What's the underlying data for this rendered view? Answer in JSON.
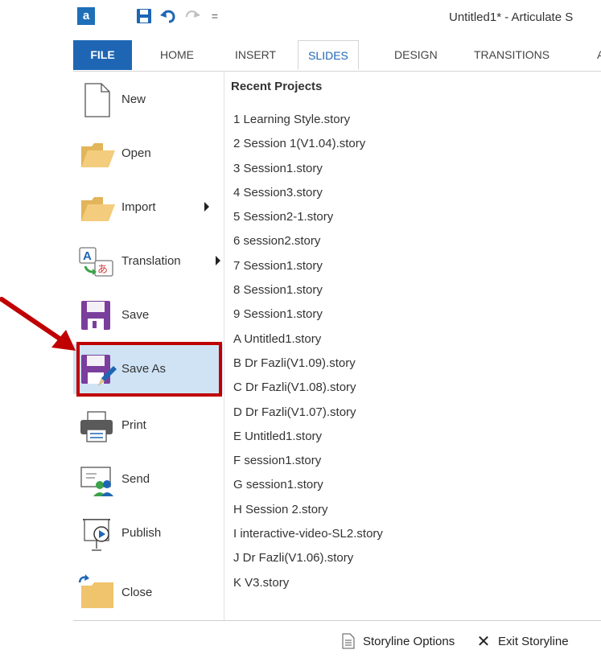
{
  "window": {
    "title": "Untitled1* - Articulate S"
  },
  "quick_access": {
    "app_icon": "storyline-app-icon",
    "app_letter": "a",
    "icons": [
      "save-icon",
      "undo-icon",
      "redo-icon",
      "customize-icon"
    ],
    "customize_glyph": "="
  },
  "ribbon": {
    "tabs": {
      "file": "FILE",
      "home": "HOME",
      "insert": "INSERT",
      "slides": "SLIDES",
      "design": "DESIGN",
      "transitions": "TRANSITIONS",
      "a": "A"
    },
    "active_tab": "SLIDES"
  },
  "backstage": {
    "menu": {
      "new": "New",
      "open": "Open",
      "import": "Import",
      "translation": "Translation",
      "save": "Save",
      "save_as": "Save As",
      "print": "Print",
      "send": "Send",
      "publish": "Publish",
      "close": "Close"
    },
    "selected_item": "Save As",
    "recent": {
      "heading": "Recent Projects",
      "items": [
        "1 Learning Style.story",
        "2 Session 1(V1.04).story",
        "3 Session1.story",
        "4 Session3.story",
        "5 Session2-1.story",
        "6 session2.story",
        "7 Session1.story",
        "8 Session1.story",
        "9 Session1.story",
        "A Untitled1.story",
        "B Dr Fazli(V1.09).story",
        "C Dr Fazli(V1.08).story",
        "D Dr Fazli(V1.07).story",
        "E Untitled1.story",
        "F session1.story",
        "G session1.story",
        "H Session 2.story",
        "I interactive-video-SL2.story",
        "J Dr Fazli(V1.06).story",
        "K V3.story"
      ]
    },
    "bottom": {
      "options_label": "Storyline Options",
      "exit_label": "Exit Storyline",
      "exit_glyph": "✕"
    }
  },
  "colors": {
    "file_tab": "#1e66b4",
    "active_tab_text": "#1e66b4",
    "selected_bg": "#cfe3f5",
    "highlight_border": "#c00000",
    "annotation_arrow": "#c00000",
    "folder": "#f0c36d",
    "floppy": "#7a3e9d"
  }
}
